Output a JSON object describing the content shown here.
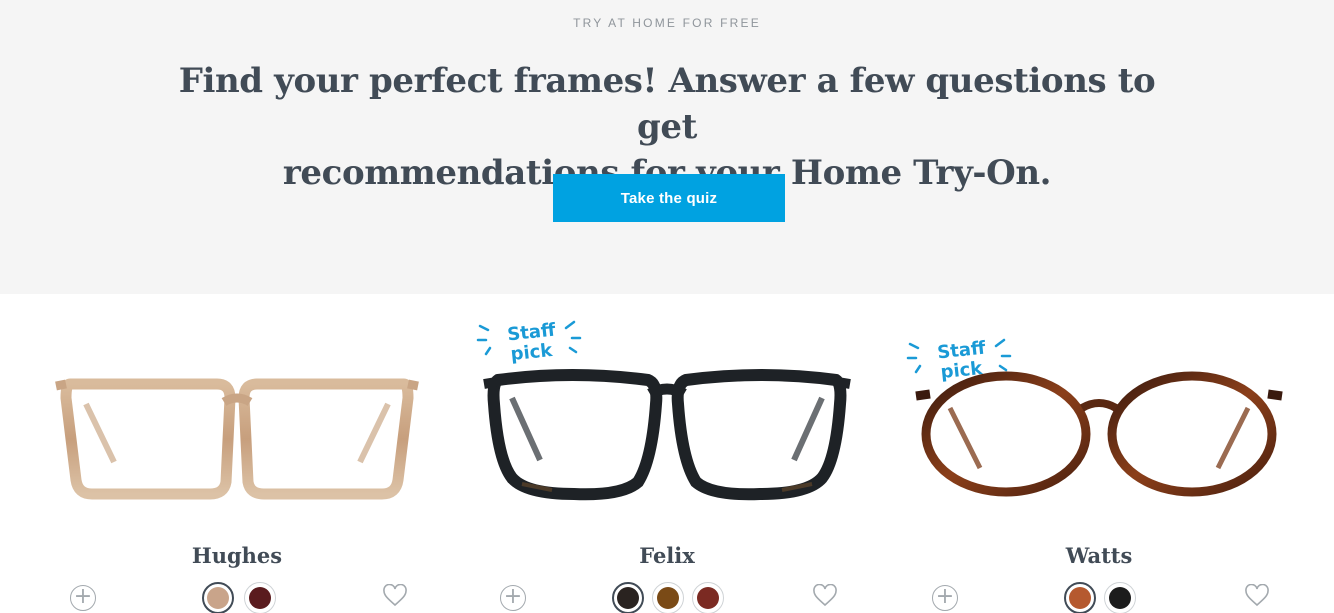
{
  "hero": {
    "eyebrow": "TRY AT HOME FOR FREE",
    "headline_line1": "Find your perfect frames! Answer a few questions to get",
    "headline_line2": "recommendations for your Home Try-On.",
    "cta_label": "Take the quiz",
    "cta_color": "#00a2e1"
  },
  "staff_pick": {
    "line1": "Staff",
    "line2": "pick",
    "color": "#1a9ad6"
  },
  "products": [
    {
      "name": "Hughes",
      "staff_pick": false,
      "swatches": [
        {
          "color": "#c9a48a",
          "selected": true
        },
        {
          "color": "#5a1b1e",
          "selected": false
        }
      ]
    },
    {
      "name": "Felix",
      "staff_pick": true,
      "swatches": [
        {
          "color": "#2a2320",
          "selected": true
        },
        {
          "color": "#7a4a16",
          "selected": false
        },
        {
          "color": "#7b2a22",
          "selected": false
        }
      ]
    },
    {
      "name": "Watts",
      "staff_pick": true,
      "swatches": [
        {
          "color": "#b5592f",
          "selected": true
        },
        {
          "color": "#1c1c1c",
          "selected": false
        }
      ]
    }
  ],
  "icons": {
    "add": "plus-circle-icon",
    "favorite": "heart-outline-icon"
  }
}
